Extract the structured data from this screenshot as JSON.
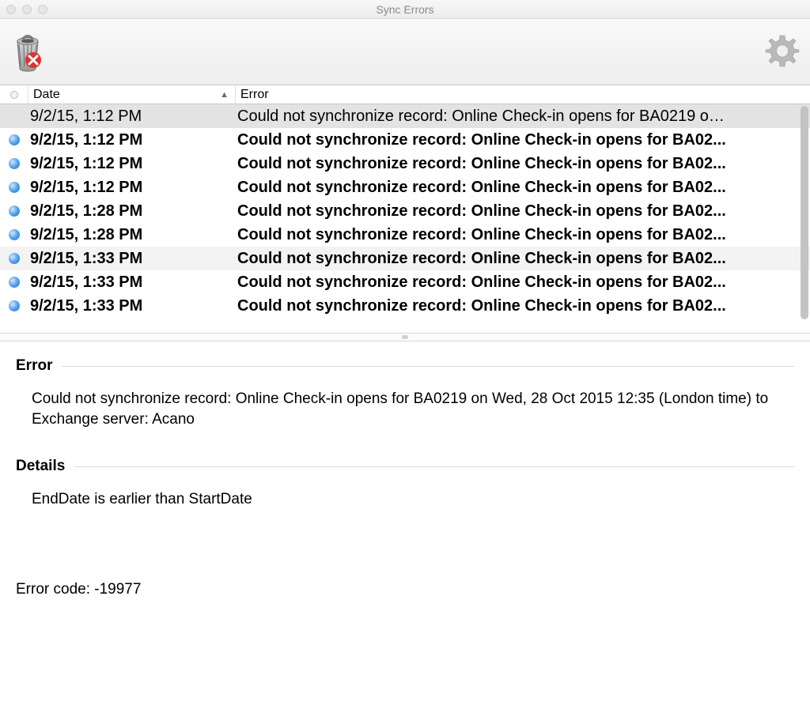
{
  "window": {
    "title": "Sync Errors"
  },
  "columns": {
    "date": "Date",
    "error": "Error"
  },
  "rows": [
    {
      "date": "9/2/15, 1:12 PM",
      "error": "Could not synchronize record: Online Check-in opens for BA0219 o…",
      "selected": true,
      "unread": false
    },
    {
      "date": "9/2/15, 1:12 PM",
      "error": "Could not synchronize record: Online Check-in opens for BA02...",
      "selected": false,
      "unread": true
    },
    {
      "date": "9/2/15, 1:12 PM",
      "error": "Could not synchronize record: Online Check-in opens for BA02...",
      "selected": false,
      "unread": true
    },
    {
      "date": "9/2/15, 1:12 PM",
      "error": "Could not synchronize record: Online Check-in opens for BA02...",
      "selected": false,
      "unread": true
    },
    {
      "date": "9/2/15, 1:28 PM",
      "error": "Could not synchronize record: Online Check-in opens for BA02...",
      "selected": false,
      "unread": true
    },
    {
      "date": "9/2/15, 1:28 PM",
      "error": "Could not synchronize record: Online Check-in opens for BA02...",
      "selected": false,
      "unread": true
    },
    {
      "date": "9/2/15, 1:33 PM",
      "error": "Could not synchronize record: Online Check-in opens for BA02...",
      "selected": false,
      "unread": true,
      "alt": true
    },
    {
      "date": "9/2/15, 1:33 PM",
      "error": "Could not synchronize record: Online Check-in opens for BA02...",
      "selected": false,
      "unread": true
    },
    {
      "date": "9/2/15, 1:33 PM",
      "error": "Could not synchronize record: Online Check-in opens for BA02...",
      "selected": false,
      "unread": true
    }
  ],
  "detail": {
    "error_label": "Error",
    "error_text": "Could not synchronize record: Online Check-in opens for BA0219 on Wed, 28 Oct 2015 12:35 (London time) to Exchange server: Acano",
    "details_label": "Details",
    "details_text": "EndDate is earlier than StartDate",
    "error_code_label": "Error code:",
    "error_code_value": "-19977"
  }
}
